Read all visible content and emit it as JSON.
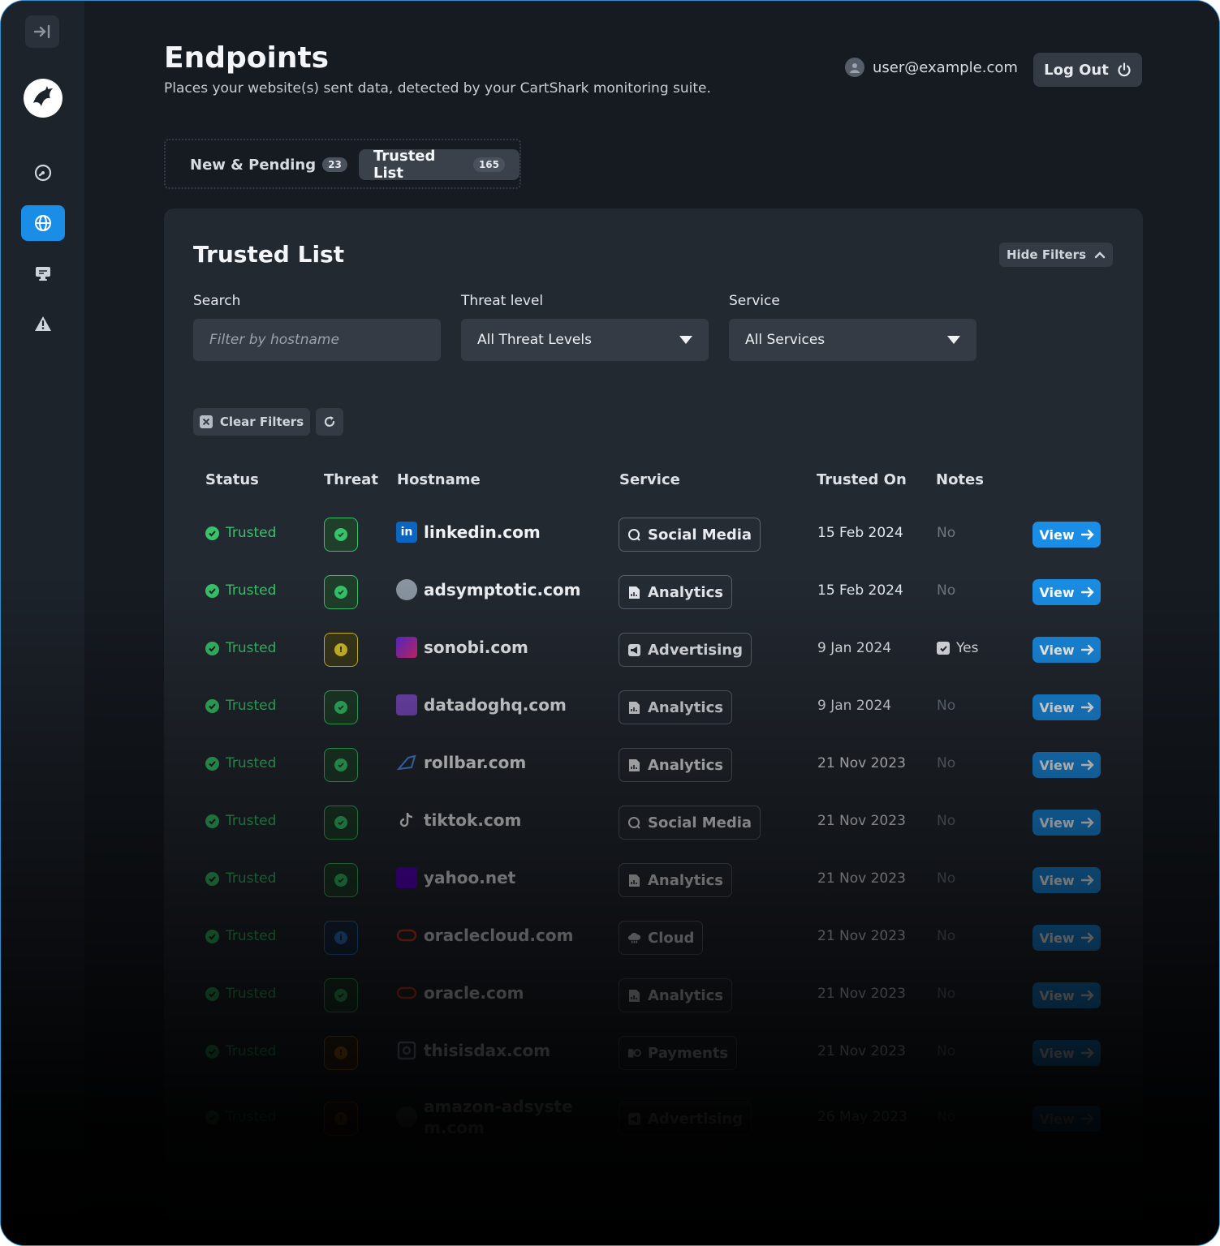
{
  "page": {
    "title": "Endpoints",
    "subtitle": "Places your website(s) sent data, detected by your CartShark monitoring suite."
  },
  "user": {
    "email": "user@example.com",
    "logout_label": "Log Out"
  },
  "sidebar": {
    "items": [
      {
        "icon": "expand-icon"
      },
      {
        "icon": "shark-logo"
      },
      {
        "icon": "dashboard-gauge-icon"
      },
      {
        "icon": "globe-icon",
        "active": true
      },
      {
        "icon": "monitor-icon"
      },
      {
        "icon": "alert-icon"
      }
    ]
  },
  "tabs": [
    {
      "label": "New & Pending",
      "count": "23"
    },
    {
      "label": "Trusted List",
      "count": "165",
      "active": true
    }
  ],
  "card": {
    "title": "Trusted List",
    "hide_filters_label": "Hide Filters"
  },
  "filters": {
    "search_label": "Search",
    "search_placeholder": "Filter by hostname",
    "threat_label": "Threat level",
    "threat_value": "All Threat Levels",
    "service_label": "Service",
    "service_value": "All Services",
    "clear_label": "Clear Filters"
  },
  "table": {
    "columns": [
      "Status",
      "Threat",
      "Hostname",
      "Service",
      "Trusted On",
      "Notes"
    ],
    "view_label": "View",
    "rows": [
      {
        "status": "Trusted",
        "threat": "low",
        "hostname": "linkedin.com",
        "service": "Social Media",
        "trusted_on": "15 Feb 2024",
        "notes": "No"
      },
      {
        "status": "Trusted",
        "threat": "low",
        "hostname": "adsymptotic.com",
        "service": "Analytics",
        "trusted_on": "15 Feb 2024",
        "notes": "No"
      },
      {
        "status": "Trusted",
        "threat": "medium",
        "hostname": "sonobi.com",
        "service": "Advertising",
        "trusted_on": "9 Jan 2024",
        "notes": "Yes"
      },
      {
        "status": "Trusted",
        "threat": "low",
        "hostname": "datadoghq.com",
        "service": "Analytics",
        "trusted_on": "9 Jan 2024",
        "notes": "No"
      },
      {
        "status": "Trusted",
        "threat": "low",
        "hostname": "rollbar.com",
        "service": "Analytics",
        "trusted_on": "21 Nov 2023",
        "notes": "No"
      },
      {
        "status": "Trusted",
        "threat": "low",
        "hostname": "tiktok.com",
        "service": "Social Media",
        "trusted_on": "21 Nov 2023",
        "notes": "No"
      },
      {
        "status": "Trusted",
        "threat": "low",
        "hostname": "yahoo.net",
        "service": "Analytics",
        "trusted_on": "21 Nov 2023",
        "notes": "No"
      },
      {
        "status": "Trusted",
        "threat": "info",
        "hostname": "oraclecloud.com",
        "service": "Cloud",
        "trusted_on": "21 Nov 2023",
        "notes": "No"
      },
      {
        "status": "Trusted",
        "threat": "low",
        "hostname": "oracle.com",
        "service": "Analytics",
        "trusted_on": "21 Nov 2023",
        "notes": "No"
      },
      {
        "status": "Trusted",
        "threat": "high",
        "hostname": "thisisdax.com",
        "service": "Payments",
        "trusted_on": "21 Nov 2023",
        "notes": "No"
      },
      {
        "status": "Trusted",
        "threat": "high",
        "hostname": "amazon-adsystem.com",
        "service": "Advertising",
        "trusted_on": "26 May 2023",
        "notes": "No"
      }
    ]
  },
  "colors": {
    "accent": "#1a8ee6",
    "trusted_green": "#35c46a",
    "threat_low": "#35c46a",
    "threat_medium": "#d8c32a",
    "threat_info": "#2f7fd6",
    "threat_high": "#e0861e"
  }
}
